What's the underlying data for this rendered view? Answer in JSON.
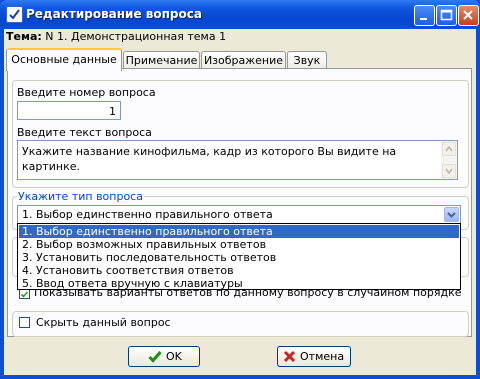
{
  "window": {
    "title": "Редактирование вопроса"
  },
  "theme": {
    "label": "Тема:",
    "value": "N 1. Демонстрационная тема 1"
  },
  "tabs": [
    {
      "label": "Основные данные"
    },
    {
      "label": "Примечание"
    },
    {
      "label": "Изображение"
    },
    {
      "label": "Звук"
    }
  ],
  "question_number": {
    "label": "Введите номер вопроса",
    "value": "1"
  },
  "question_text": {
    "label": "Введите текст вопроса",
    "value": "Укажите название кинофильма, кадр из которого Вы видите на картинке."
  },
  "question_type": {
    "group_label": "Укажите тип вопроса",
    "selected": "1. Выбор единственно правильного ответа",
    "options": [
      "1. Выбор единственно правильного ответа",
      "2. Выбор возможных правильных ответов",
      "3. Установить последовательность ответов",
      "4. Установить соответствия ответов",
      "5. Ввод ответа вручную с клавиатуры"
    ]
  },
  "random_order": {
    "label": "Показывать варианты ответов по данному вопросу в случайном порядке",
    "checked": true
  },
  "hide_question": {
    "label": "Скрыть данный вопрос",
    "checked": false
  },
  "buttons": {
    "ok": "OK",
    "cancel": "Отмена"
  }
}
